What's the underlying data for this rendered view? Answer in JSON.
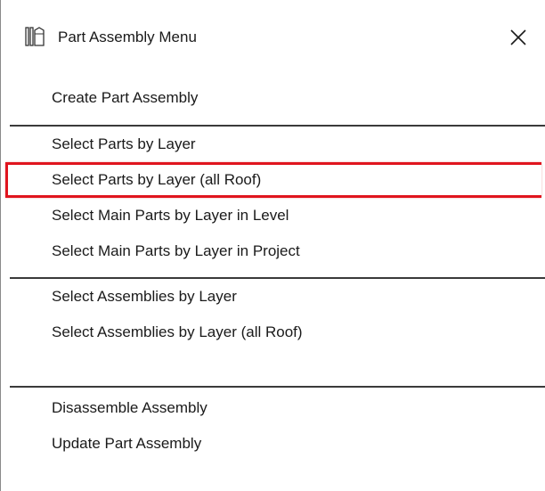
{
  "window": {
    "title": "Part Assembly Menu",
    "icon": "columns-building-icon",
    "close_icon": "close-x-icon"
  },
  "menu": {
    "groups": [
      {
        "items": [
          {
            "label": "Create Part Assembly"
          }
        ]
      },
      {
        "items": [
          {
            "label": "Select Parts by Layer"
          },
          {
            "label": "Select Parts by Layer (all Roof)",
            "highlighted": true
          },
          {
            "label": "Select Main Parts by Layer in Level"
          },
          {
            "label": "Select Main Parts by Layer in Project"
          }
        ]
      },
      {
        "items": [
          {
            "label": "Select Assemblies by Layer"
          },
          {
            "label": "Select Assemblies by Layer (all Roof)"
          }
        ]
      },
      {
        "items": [
          {
            "label": "Disassemble Assembly"
          },
          {
            "label": "Update Part Assembly"
          }
        ]
      }
    ]
  },
  "colors": {
    "highlight_border": "#e0141e",
    "separator": "#3a3a3a",
    "text": "#1a1a1a",
    "background": "#ffffff"
  }
}
